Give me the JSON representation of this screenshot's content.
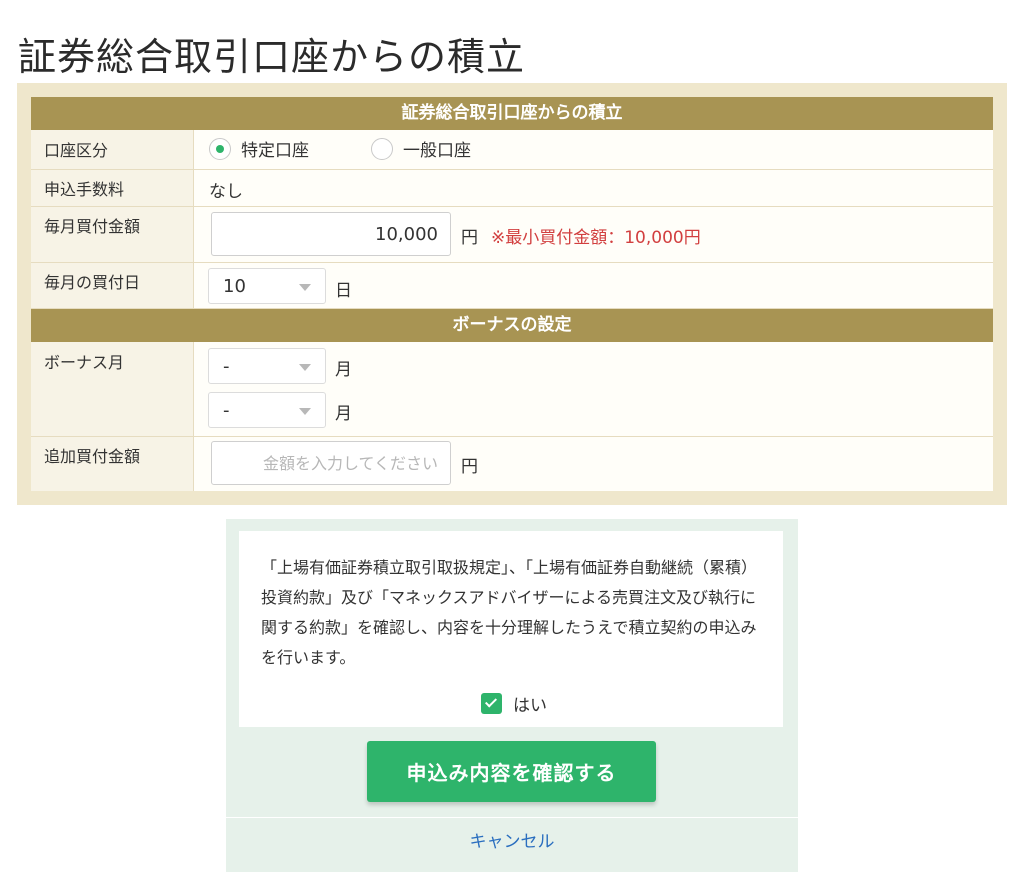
{
  "page": {
    "title": "証券総合取引口座からの積立"
  },
  "form": {
    "section_main_title": "証券総合取引口座からの積立",
    "account_type": {
      "label": "口座区分",
      "options": [
        {
          "label": "特定口座",
          "selected": true
        },
        {
          "label": "一般口座",
          "selected": false
        }
      ]
    },
    "fee": {
      "label": "申込手数料",
      "value": "なし"
    },
    "monthly_amount": {
      "label": "毎月買付金額",
      "value": "10,000",
      "unit": "円",
      "note": "※最小買付金額：10,000円"
    },
    "monthly_day": {
      "label": "毎月の買付日",
      "value": "10",
      "unit": "日"
    },
    "section_bonus_title": "ボーナスの設定",
    "bonus_month": {
      "label": "ボーナス月",
      "selects": [
        {
          "value": "-",
          "unit": "月"
        },
        {
          "value": "-",
          "unit": "月"
        }
      ]
    },
    "bonus_amount": {
      "label": "追加買付金額",
      "value": "",
      "placeholder": "金額を入力してください",
      "unit": "円"
    }
  },
  "agreement": {
    "text": "「上場有価証券積立取引取扱規定」、「上場有価証券自動継続（累積）投資約款」及び「マネックスアドバイザーによる売買注文及び執行に関する約款」を確認し、内容を十分理解したうえで積立契約の申込みを行います。",
    "checkbox_label": "はい",
    "checked": true
  },
  "actions": {
    "confirm_label": "申込み内容を確認する",
    "cancel_label": "キャンセル"
  },
  "colors": {
    "header_bg": "#a89453",
    "frame_bg": "#efe7cc",
    "accent_green": "#2eb46b",
    "note_red": "#d23f3f",
    "link_blue": "#2a6ebf"
  }
}
